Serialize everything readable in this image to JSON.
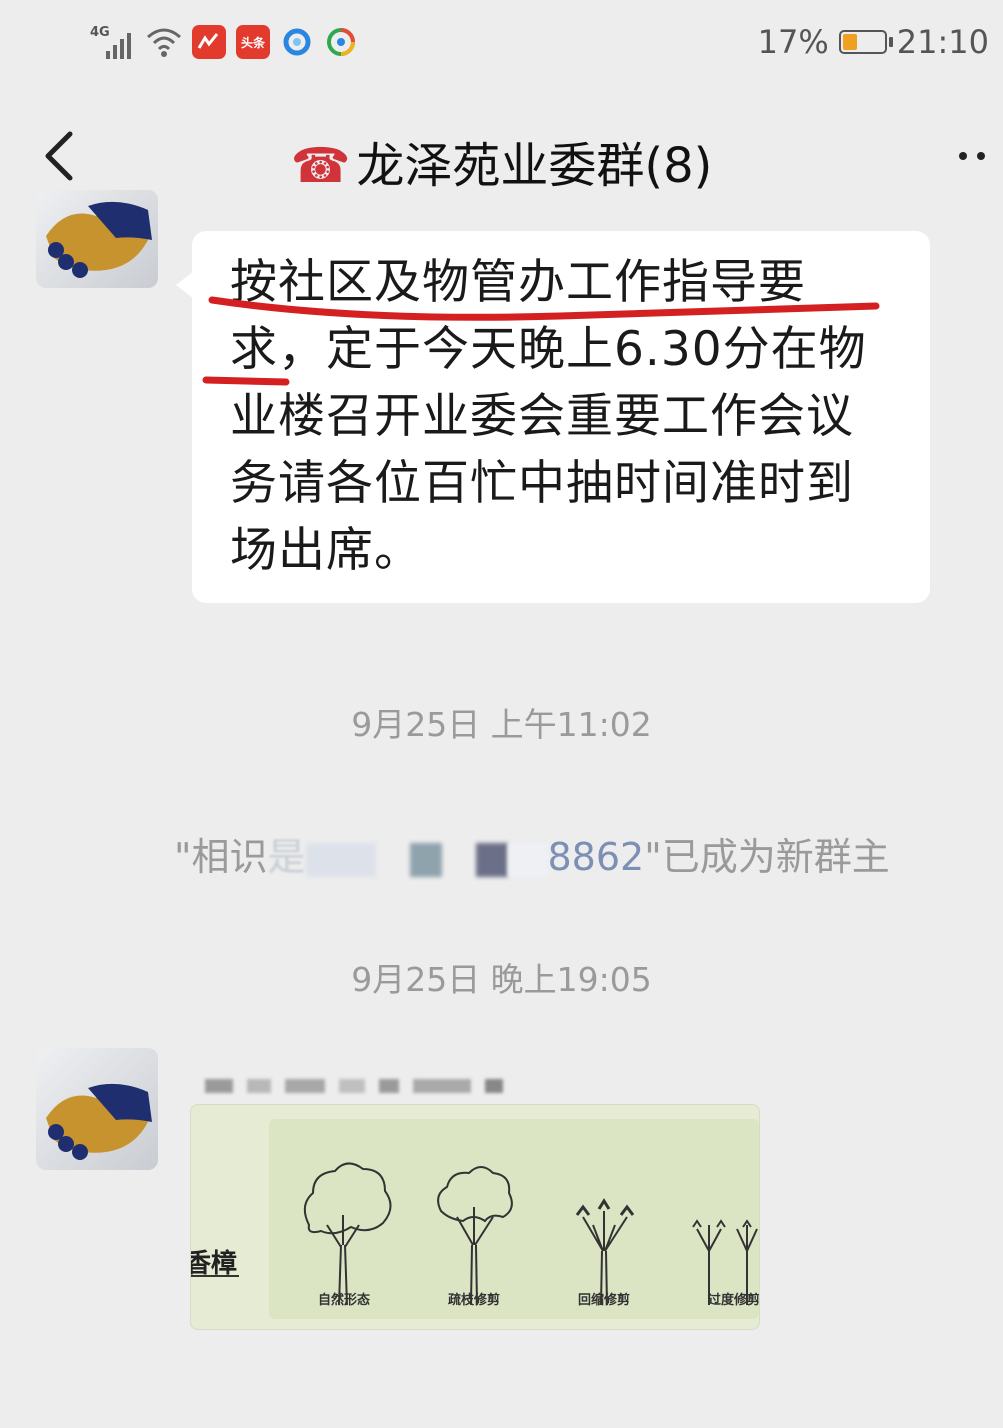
{
  "status_bar": {
    "network": "4G",
    "app_badge_toutiao": "头条",
    "battery": "17%",
    "battery_level": 0.17,
    "time": "21:10"
  },
  "header": {
    "title": "龙泽苑业委群(8)",
    "phone_icon": "☎"
  },
  "messages": {
    "bubble_1": {
      "lines": [
        "按社区及物管办工作指导要",
        "求，定于今天晚上6.30分在物",
        "业楼召开业委会重要工作会议",
        "务请各位百忙中抽时间准时到",
        "场出席。"
      ]
    },
    "timestamp_1": "9月25日 上午11:02",
    "system_message": {
      "prefix": "\"相识",
      "partial_char": "是",
      "suffix_visible": "8862",
      "tail": "\"已成为新群主"
    },
    "timestamp_2": "9月25日 晚上19:05",
    "image_message": {
      "side_text": "香樟",
      "tree_labels": [
        "自然形态",
        "疏枝修剪",
        "回缩修剪",
        "过度修剪"
      ]
    }
  },
  "colors": {
    "background": "#ededed",
    "bubble": "#ffffff",
    "annotation_red": "#d42020",
    "timestamp_text": "#9a9a9a"
  }
}
